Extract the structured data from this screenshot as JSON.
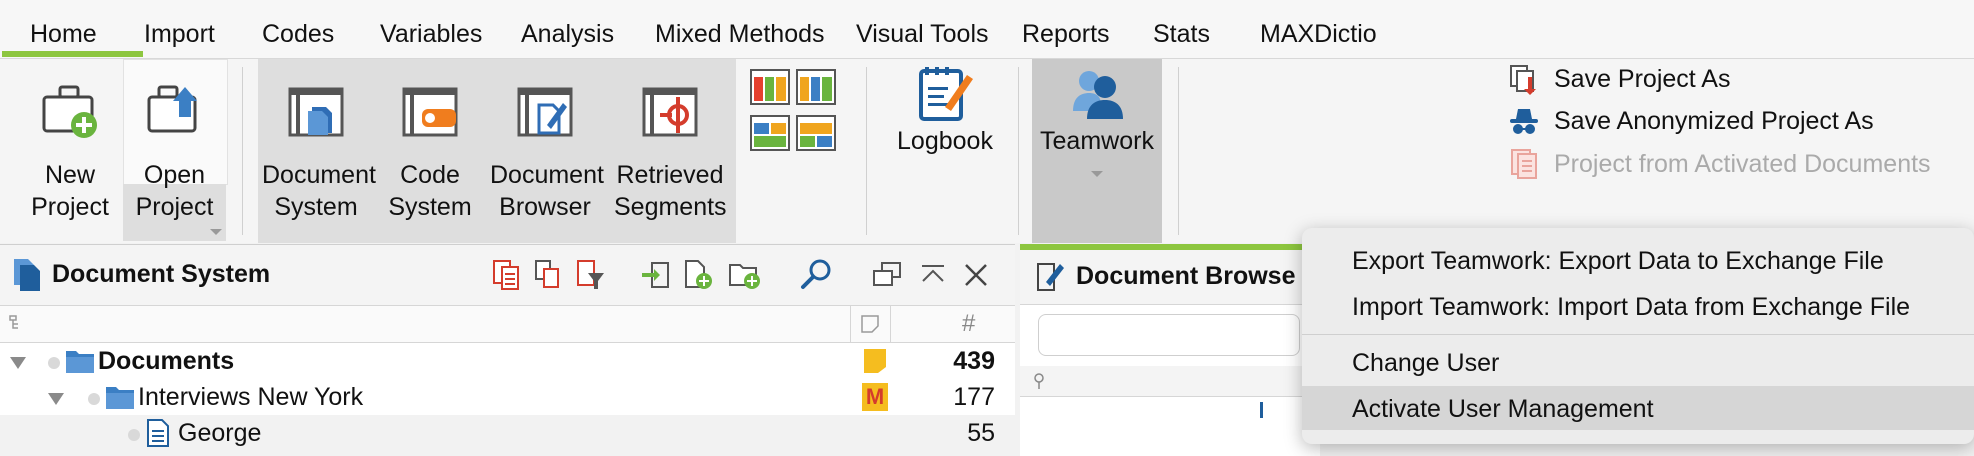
{
  "tabs": [
    "Home",
    "Import",
    "Codes",
    "Variables",
    "Analysis",
    "Mixed Methods",
    "Visual Tools",
    "Reports",
    "Stats",
    "MAXDictio"
  ],
  "ribbon": {
    "new_project": [
      "New",
      "Project"
    ],
    "open_project": [
      "Open",
      "Project"
    ],
    "document_system": [
      "Document",
      "System"
    ],
    "code_system": [
      "Code",
      "System"
    ],
    "document_browser": [
      "Document",
      "Browser"
    ],
    "retrieved_segments": [
      "Retrieved",
      "Segments"
    ],
    "logbook": "Logbook",
    "teamwork": "Teamwork",
    "save_project_as": "Save Project As",
    "save_anonymized": "Save Anonymized Project As",
    "project_from_activated": "Project from Activated Documents"
  },
  "document_system": {
    "title": "Document System",
    "col_hash": "#",
    "rows": [
      {
        "name": "Documents",
        "count": "439"
      },
      {
        "name": "Interviews New York",
        "count": "177"
      },
      {
        "name": "George",
        "count": "55"
      }
    ],
    "memo_letter": "M"
  },
  "document_browser": {
    "title": "Document Browse"
  },
  "teamwork_menu": {
    "items": [
      "Export Teamwork: Export Data to Exchange File",
      "Import Teamwork: Import Data from Exchange File",
      "Change User",
      "Activate User Management"
    ]
  },
  "colors": {
    "accent_green": "#8dc63f",
    "maxqda_blue": "#1f5e9c",
    "orange": "#f07d1e",
    "red": "#d43c2c"
  }
}
